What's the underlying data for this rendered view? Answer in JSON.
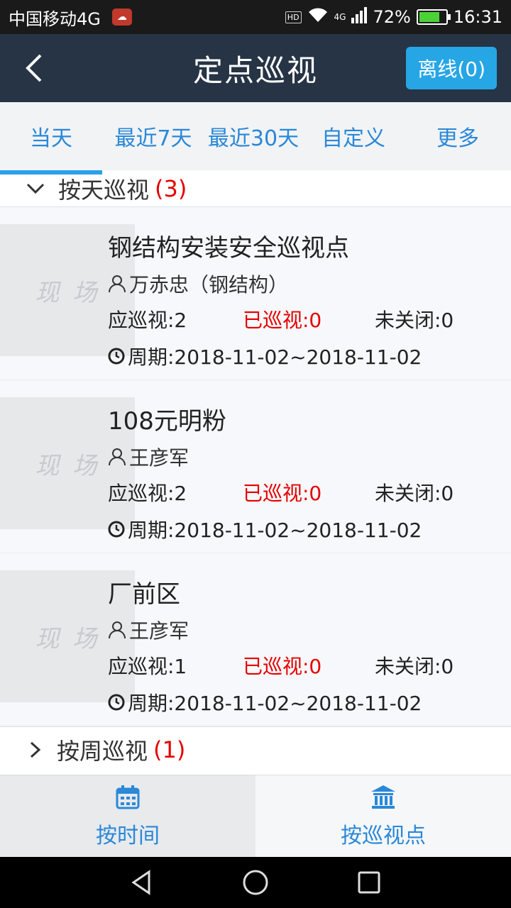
{
  "status_bar": {
    "carrier": "中国移动4G",
    "hd": "HD",
    "network": "4G",
    "battery": "72%",
    "time": "16:31"
  },
  "header": {
    "title": "定点巡视",
    "offline_label": "离线(0)"
  },
  "tabs": [
    {
      "label": "当天"
    },
    {
      "label": "最近7天"
    },
    {
      "label": "最近30天"
    },
    {
      "label": "自定义"
    },
    {
      "label": "更多"
    }
  ],
  "groups": [
    {
      "label": "按天巡视",
      "count": "(3)"
    },
    {
      "label": "按周巡视",
      "count": "(1)"
    }
  ],
  "items": [
    {
      "thumb_text": "现 场",
      "name": "钢结构安装安全巡视点",
      "person": "万赤忠（钢结构）",
      "should": "应巡视:2",
      "done": "已巡视:0",
      "open": "未关闭:0",
      "period": "周期:2018-11-02~2018-11-02"
    },
    {
      "thumb_text": "现 场",
      "name": "108元明粉",
      "person": "王彦军",
      "should": "应巡视:2",
      "done": "已巡视:0",
      "open": "未关闭:0",
      "period": "周期:2018-11-02~2018-11-02"
    },
    {
      "thumb_text": "现 场",
      "name": "厂前区",
      "person": "王彦军",
      "should": "应巡视:1",
      "done": "已巡视:0",
      "open": "未关闭:0",
      "period": "周期:2018-11-02~2018-11-02"
    }
  ],
  "bottom_nav": [
    {
      "label": "按时间",
      "icon": "calendar-icon"
    },
    {
      "label": "按巡视点",
      "icon": "bank-icon"
    }
  ],
  "colors": {
    "header_bg": "#263445",
    "accent": "#2a88d8",
    "alert": "#e60000"
  }
}
